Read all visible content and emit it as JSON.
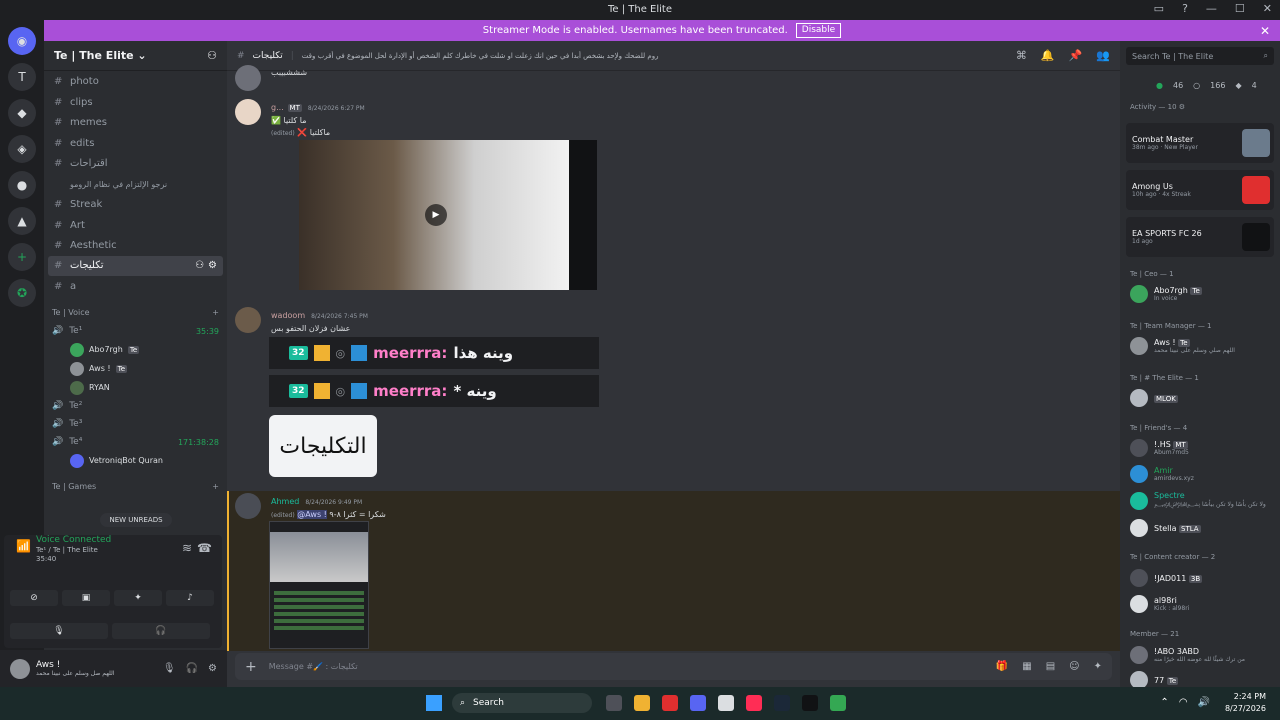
{
  "window": {
    "title": "Te | The Elite"
  },
  "banner": {
    "text": "Streamer Mode is enabled. Usernames have been truncated.",
    "disable_label": "Disable",
    "color": "#a94fd8"
  },
  "server": {
    "name": "Te | The Elite"
  },
  "channels": [
    {
      "name": "photo"
    },
    {
      "name": "clips"
    },
    {
      "name": "memes"
    },
    {
      "name": "edits"
    },
    {
      "name": "اقتراحات"
    },
    {
      "name": "نرجو الإلتزام في نظام الرومو"
    },
    {
      "name": "Streak"
    },
    {
      "name": "Art"
    },
    {
      "name": "Aesthetic"
    },
    {
      "name": "تكليجات"
    },
    {
      "name": "a"
    }
  ],
  "voice": {
    "category": "Te | Voice",
    "channels": [
      {
        "name": "Te¹",
        "time": "35:39"
      },
      {
        "name": "Te²",
        "time": ""
      },
      {
        "name": "Te³",
        "time": ""
      },
      {
        "name": "Te⁴",
        "time": "171:38:28"
      }
    ],
    "users": [
      {
        "name": "Abo7rgh",
        "tag": "Te"
      },
      {
        "name": "Aws !",
        "tag": "Te"
      },
      {
        "name": "RYAN",
        "tag": ""
      }
    ],
    "bot": "VetroniqBot Quran",
    "games_category": "Te | Games",
    "new_unreads": "NEW UNREADS"
  },
  "voice_panel": {
    "status": "Voice Connected",
    "channel": "Te¹ / Te | The Elite",
    "time": "35:40"
  },
  "user_panel": {
    "name": "Aws !",
    "status": "اللهم صل وسلم على نبينا محمد"
  },
  "channel_header": {
    "name": "تكليجات",
    "topic": "روم للضحك ولإحد بشخص أبدا في حين انك زعلت او شلت في خاطرك كلم الشخص أو الإدارة لحل الموضوع في أقرب وقت"
  },
  "messages": [
    {
      "author": "",
      "text": "شششبيبب",
      "time": ""
    },
    {
      "author": "g...",
      "tag": "MT",
      "time": "8/24/2026 6:27 PM",
      "text": "✅ ما كلتيا",
      "edited": "(edited)",
      "text2": "❌ ماكلتيا"
    },
    {
      "author": "wadoom",
      "time": "8/24/2026 7:45 PM",
      "text": "عشان فزلان الحتفو بس"
    },
    {
      "author": "Ahmed",
      "time": "8/24/2026 9:49 PM",
      "edited": "(edited)",
      "mention": "@Aws !",
      "text": "شكرا = كثرا ٨-٩"
    }
  ],
  "embeds": [
    {
      "level": "32",
      "name": "meerrra:",
      "text": "وينه هذا"
    },
    {
      "level": "32",
      "name": "meerrra:",
      "text": "* وينه"
    }
  ],
  "sticker": "التكليجات",
  "composer": {
    "placeholder": "Message #🖌️ : تكليجات"
  },
  "member_search": {
    "placeholder": "Search Te | The Elite"
  },
  "stats": {
    "online": "46",
    "idle": "166",
    "boost": "4"
  },
  "activity": {
    "header": "Activity — 10",
    "cards": [
      {
        "game": "Combat Master",
        "meta": "38m ago · New Player",
        "art_color": "#6b7b8c"
      },
      {
        "game": "Among Us",
        "meta": "10h ago · 4x Streak",
        "art_color": "#e02f2f"
      },
      {
        "game": "EA SPORTS FC 26",
        "meta": "1d ago",
        "art_color": "#111214"
      }
    ]
  },
  "member_groups": [
    {
      "title": "Te | Ceo — 1",
      "members": [
        {
          "name": "Abo7rgh",
          "tag": "Te",
          "sub": "In voice"
        }
      ]
    },
    {
      "title": "Te | Team Manager — 1",
      "members": [
        {
          "name": "Aws !",
          "tag": "Te",
          "sub": "اللهم صلي وسلم على نبينا محمد"
        }
      ]
    },
    {
      "title": "Te | # The Elite — 1",
      "members": [
        {
          "name": "",
          "tag": "MLOK",
          "sub": ""
        }
      ]
    },
    {
      "title": "Te | Friend's — 4",
      "members": [
        {
          "name": "!.HS",
          "tag": "MT",
          "sub": "Abum7md5"
        },
        {
          "name": "Amir",
          "tag": "",
          "sub": "amirdevs.xyz"
        },
        {
          "name": "Spectre",
          "tag": "",
          "sub": "﷽ ولا تكن بأسًا ولا تكن بيأسًا"
        },
        {
          "name": "Stella",
          "tag": "STLA",
          "sub": ""
        }
      ]
    },
    {
      "title": "Te | Content creator — 2",
      "members": [
        {
          "name": "!JAD011",
          "tag": "3B",
          "sub": ""
        },
        {
          "name": "al98ri",
          "tag": "",
          "sub": "Kick : al98ri"
        }
      ]
    },
    {
      "title": "Member — 21",
      "members": [
        {
          "name": "!ABO 3ABD",
          "tag": "",
          "sub": "من ترك شيئًا لله عوضه الله خيرًا منه"
        },
        {
          "name": "77",
          "tag": "Te",
          "sub": ""
        }
      ]
    }
  ],
  "taskbar": {
    "search": "Search",
    "time": "2:24 PM",
    "date": "8/27/2026"
  }
}
